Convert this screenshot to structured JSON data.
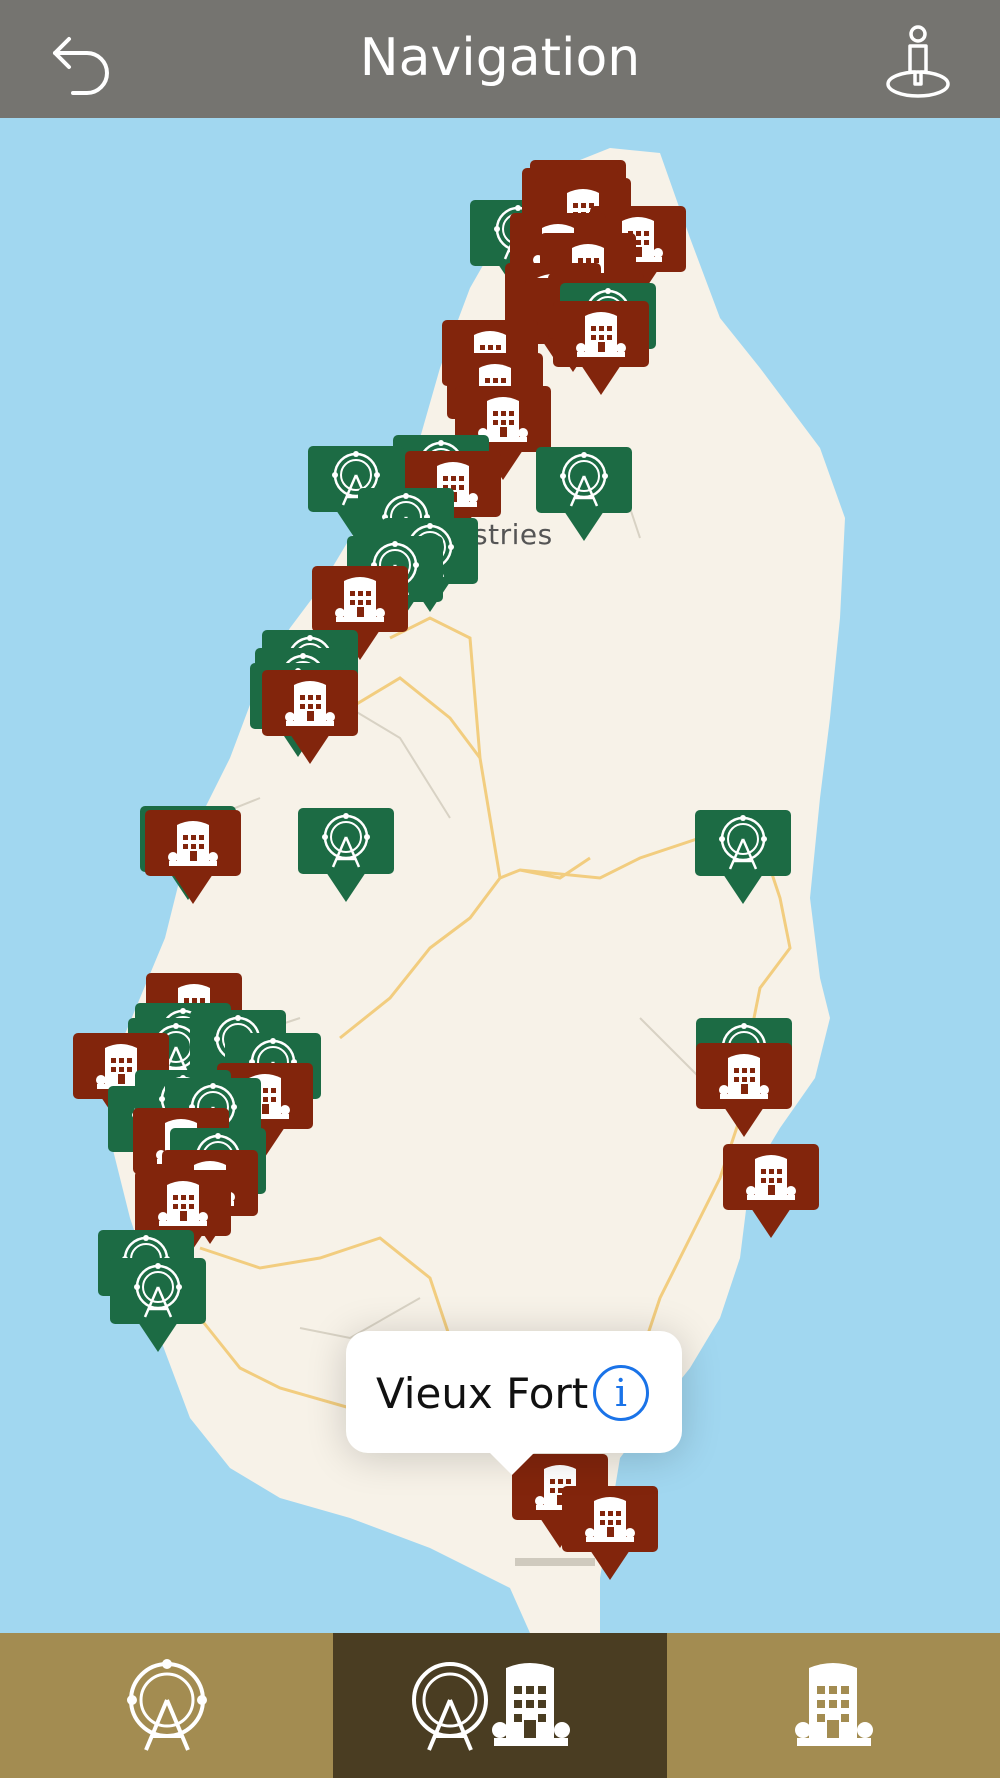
{
  "header": {
    "title": "Navigation",
    "back_icon": "back-arrow-icon",
    "location_icon": "user-location-icon",
    "bg_color": "#757470"
  },
  "map": {
    "label": "stries",
    "water_color": "#a1d7f0",
    "land_color": "#f7f2e8",
    "hotel_color": "#82250c",
    "attraction_color": "#1c6b44",
    "selected_callout": {
      "title": "Vieux Fort",
      "info_icon": "info-icon",
      "info_glyph": "i"
    }
  },
  "tabs": [
    {
      "name": "attractions",
      "icon": "ferris-wheel-icon",
      "active": false
    },
    {
      "name": "all",
      "icon": "ferris-wheel-and-hotel-icon",
      "active": true
    },
    {
      "name": "hotels",
      "icon": "hotel-icon",
      "active": false
    }
  ],
  "tab_colors": {
    "inactive": "#a38c51",
    "active": "#4a3d22"
  }
}
